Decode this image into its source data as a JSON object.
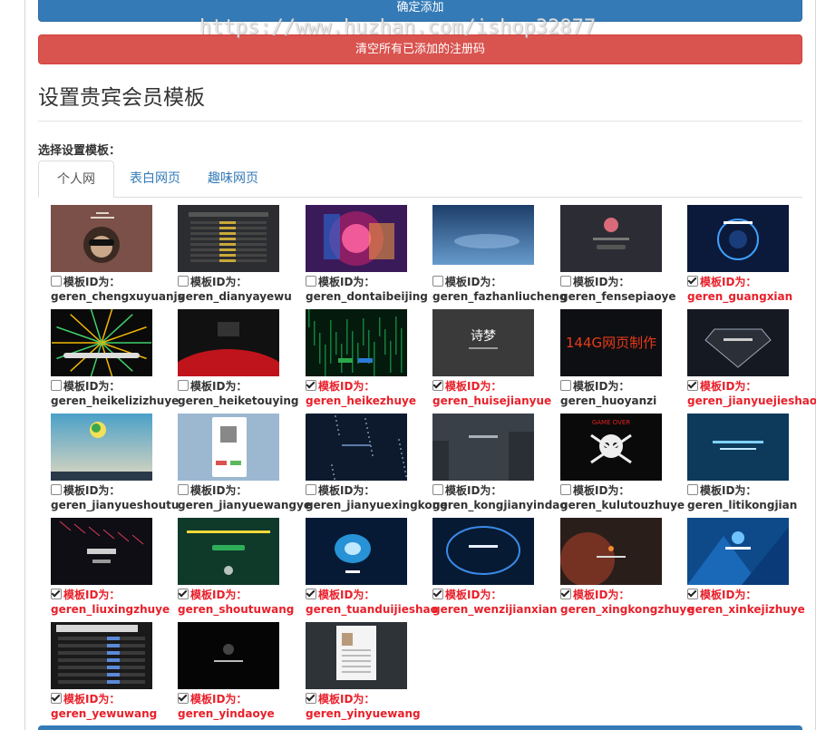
{
  "buttons": {
    "confirm_label": "确定添加",
    "clear_label": "清空所有已添加的注册码"
  },
  "watermark": "https://www.huzhan.com/ishop32877",
  "section": {
    "title": "设置贵宾会员模板",
    "choose_label": "选择设置模板："
  },
  "tabs": [
    {
      "label": "个人网页",
      "active": true
    },
    {
      "label": "表白网页",
      "active": false
    },
    {
      "label": "趣味网页",
      "active": false
    }
  ],
  "id_prefix": "模板ID为：",
  "templates": [
    {
      "id": "geren_chengxuyuanjs",
      "checked": false,
      "bg": "#7a5048",
      "accent": "#e0d6c8",
      "art": "monkey"
    },
    {
      "id": "geren_dianyayewu",
      "checked": false,
      "bg": "#2c2d30",
      "accent": "#c9a93b",
      "art": "table"
    },
    {
      "id": "geren_dontaibeijing",
      "checked": false,
      "bg": "#3b1a5a",
      "accent": "#e93a7a",
      "art": "burst"
    },
    {
      "id": "geren_fazhanliucheng",
      "checked": false,
      "bg": "#28507e",
      "accent": "#9fc6ee",
      "art": "sky"
    },
    {
      "id": "geren_fensepiaoye",
      "checked": false,
      "bg": "#2c2c34",
      "accent": "#d86a7a",
      "art": "avatar"
    },
    {
      "id": "geren_guangxian",
      "checked": true,
      "bg": "#0b1a3a",
      "accent": "#3fa0ff",
      "art": "ring"
    },
    {
      "id": "geren_heikelizizhuye",
      "checked": false,
      "bg": "#0a0a0a",
      "accent": "#f2b705",
      "art": "burst2"
    },
    {
      "id": "geren_heiketouying",
      "checked": false,
      "bg": "#111111",
      "accent": "#c0141c",
      "art": "redball"
    },
    {
      "id": "geren_heikezhuye",
      "checked": true,
      "bg": "#041a0c",
      "accent": "#25d36a",
      "art": "matrix"
    },
    {
      "id": "geren_huisejianyue",
      "checked": true,
      "bg": "#3a3a3a",
      "accent": "#ffffff",
      "art": "text"
    },
    {
      "id": "geren_huoyanzi",
      "checked": false,
      "bg": "#0e0f12",
      "accent": "#e83a1a",
      "art": "fire"
    },
    {
      "id": "geren_jianyuejieshao",
      "checked": true,
      "bg": "#151a22",
      "accent": "#9aa6b8",
      "art": "superman"
    },
    {
      "id": "geren_jianyueshoutu",
      "checked": false,
      "bg": "#3f8fb3",
      "accent": "#f2e05a",
      "art": "logo"
    },
    {
      "id": "geren_jianyuewangye",
      "checked": false,
      "bg": "#9cb8d0",
      "accent": "#d9534f",
      "art": "phone"
    },
    {
      "id": "geren_jianyuexingkong",
      "checked": false,
      "bg": "#0d1a2e",
      "accent": "#5c7aa8",
      "art": "stars"
    },
    {
      "id": "geren_kongjianyindao",
      "checked": false,
      "bg": "#3a4048",
      "accent": "#a8b0b8",
      "art": "city"
    },
    {
      "id": "geren_kulutouzhuye",
      "checked": false,
      "bg": "#0a0a0a",
      "accent": "#e02020",
      "art": "skull"
    },
    {
      "id": "geren_litikongjian",
      "checked": false,
      "bg": "#0d3a5a",
      "accent": "#7fd0ff",
      "art": "text2"
    },
    {
      "id": "geren_liuxingzhuye",
      "checked": true,
      "bg": "#0e0e14",
      "accent": "#e03a5a",
      "art": "meteor"
    },
    {
      "id": "geren_shoutuwang",
      "checked": true,
      "bg": "#0f3a2a",
      "accent": "#f3d83a",
      "art": "board"
    },
    {
      "id": "geren_tuanduijieshao",
      "checked": true,
      "bg": "#061a36",
      "accent": "#2fb0ff",
      "art": "orb"
    },
    {
      "id": "geren_wenzijianxian",
      "checked": true,
      "bg": "#071a33",
      "accent": "#3a8ae8",
      "art": "arc"
    },
    {
      "id": "geren_xingkongzhuye",
      "checked": true,
      "bg": "#2a1e1a",
      "accent": "#f08a30",
      "art": "space"
    },
    {
      "id": "geren_xinkejizhuye",
      "checked": true,
      "bg": "#0e4a8a",
      "accent": "#6ec3ff",
      "art": "poly"
    },
    {
      "id": "geren_yewuwang",
      "checked": true,
      "bg": "#1a1a1a",
      "accent": "#d8d8d8",
      "art": "table2"
    },
    {
      "id": "geren_yindaoye",
      "checked": true,
      "bg": "#050505",
      "accent": "#bbbbbb",
      "art": "dark"
    },
    {
      "id": "geren_yinyuewang",
      "checked": true,
      "bg": "#2e3338",
      "accent": "#f4f4f4",
      "art": "card"
    }
  ]
}
